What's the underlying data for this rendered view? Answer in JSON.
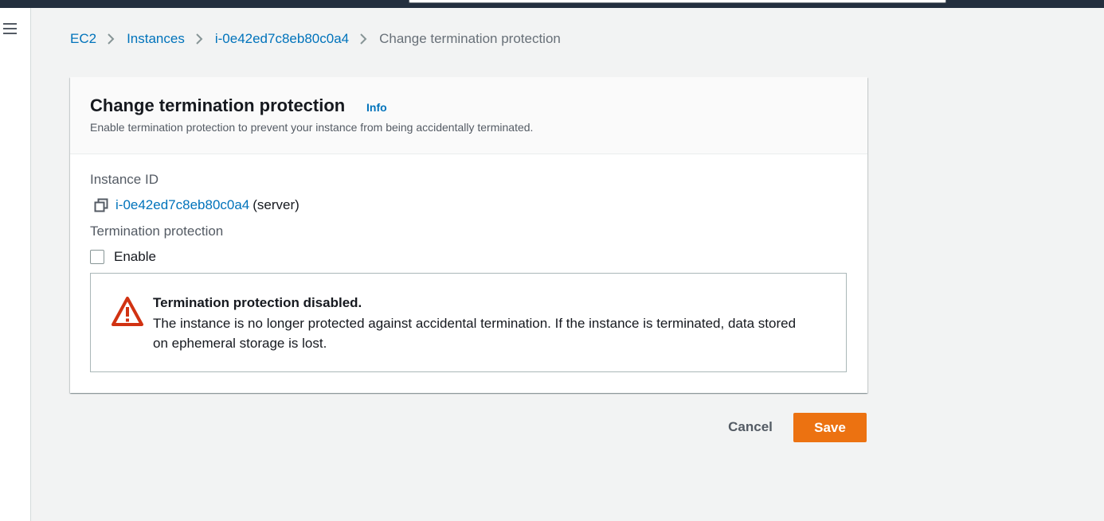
{
  "breadcrumb": {
    "items": [
      {
        "label": "EC2"
      },
      {
        "label": "Instances"
      },
      {
        "label": "i-0e42ed7c8eb80c0a4"
      },
      {
        "label": "Change termination protection"
      }
    ]
  },
  "panel": {
    "title": "Change termination protection",
    "info_label": "Info",
    "description": "Enable termination protection to prevent your instance from being accidentally terminated."
  },
  "instance": {
    "label": "Instance ID",
    "id": "i-0e42ed7c8eb80c0a4",
    "name": "(server)"
  },
  "termination": {
    "label": "Termination protection",
    "checkbox_label": "Enable",
    "checked": false
  },
  "alert": {
    "title": "Termination protection disabled.",
    "body": "The instance is no longer protected against accidental termination. If the instance is terminated, data stored on ephemeral storage is lost.",
    "icon": "warning-icon"
  },
  "actions": {
    "cancel_label": "Cancel",
    "save_label": "Save"
  },
  "colors": {
    "accent": "#ec7211",
    "link": "#0073bb",
    "warning": "#d13212",
    "topbar": "#232f3e"
  }
}
